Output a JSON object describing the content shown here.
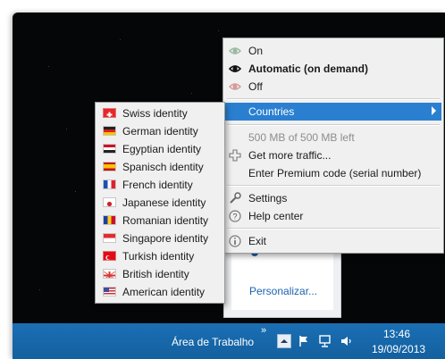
{
  "main_menu": {
    "items": [
      {
        "label": "On",
        "icon": "eye-icon-faded"
      },
      {
        "label": "Automatic (on demand)",
        "icon": "eye-icon"
      },
      {
        "label": "Off",
        "icon": "eye-icon-faded"
      },
      {
        "label": "Countries",
        "icon": "",
        "highlighted": true
      },
      {
        "label": "500 MB of 500 MB left",
        "disabled": true
      },
      {
        "label": "Get more traffic...",
        "icon": "plus-icon"
      },
      {
        "label": "Enter Premium code (serial number)"
      },
      {
        "label": "Settings",
        "icon": "wrench-icon"
      },
      {
        "label": "Help center",
        "icon": "help-icon"
      },
      {
        "label": "Exit",
        "icon": "info-icon"
      }
    ]
  },
  "countries_menu": {
    "items": [
      {
        "label": "Swiss identity",
        "flag": "swiss"
      },
      {
        "label": "German identity",
        "flag": "german"
      },
      {
        "label": "Egyptian identity",
        "flag": "egyptian"
      },
      {
        "label": "Spanisch identity",
        "flag": "spanish"
      },
      {
        "label": "French identity",
        "flag": "french"
      },
      {
        "label": "Japanese identity",
        "flag": "japanese"
      },
      {
        "label": "Romanian identity",
        "flag": "romanian"
      },
      {
        "label": "Singapore identity",
        "flag": "singapore"
      },
      {
        "label": "Turkish identity",
        "flag": "turkish"
      },
      {
        "label": "British identity",
        "flag": "british"
      },
      {
        "label": "American identity",
        "flag": "american"
      }
    ]
  },
  "background_panel": {
    "link": "Personalizar..."
  },
  "taskbar": {
    "desktop_label": "Área de Trabalho",
    "chevron": "»",
    "time": "13:46",
    "date": "19/09/2013"
  },
  "colors": {
    "highlight": "#2a7fd0",
    "taskbar": "#1a6fb4",
    "menu_bg": "#f0f0f0"
  }
}
